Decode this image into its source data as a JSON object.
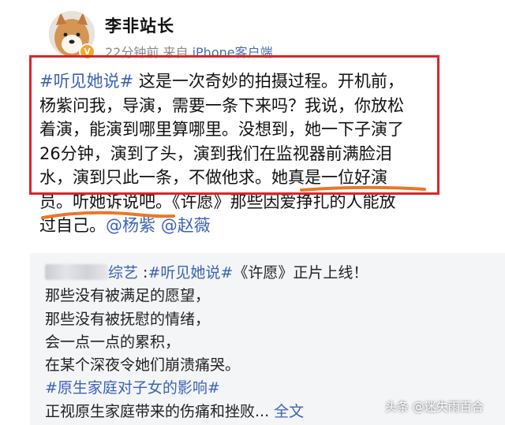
{
  "author": {
    "name": "李非站长",
    "time": "22分钟前",
    "source_prefix": "来自",
    "source": "iPhone客户端"
  },
  "post": {
    "hashtag": "#听见她说#",
    "lines": [
      " 这是一次奇妙的拍摄过程。开机前，",
      "杨紫问我，导演，需要一条下来吗？我说，你放松",
      "着演，能演到哪里算哪里。没想到，她一下子演了",
      "26分钟，演到了头，演到我们在监视器前满脸泪",
      "水，演到只此一条，不做他求。她真是一位好演",
      "员。听她诉说吧。《许愿》那些因爱挣扎的人能放"
    ],
    "last_line_prefix": "过自己。",
    "mention1": "@杨紫",
    "mention2": "@赵薇"
  },
  "repost": {
    "author_suffix": "综艺",
    "hashtag1": "#听见她说#",
    "first_line_rest": "《许愿》正片上线！",
    "lines": [
      "那些没有被满足的愿望，",
      "那些没有被抚慰的情绪，",
      "会一点一点的累积，",
      "在某个深夜令她们崩溃痛哭。"
    ],
    "hashtag2": "#原生家庭对子女的影响#",
    "last_line": "正视原生家庭带来的伤痛和挫败...",
    "full_text_link": "全文"
  },
  "watermark": "头条 @迷失雨百合",
  "colors": {
    "link": "#3b63b5",
    "highlight_box": "#d9262c",
    "underline": "#e8772a",
    "repost_bg": "#f4f5f7"
  }
}
